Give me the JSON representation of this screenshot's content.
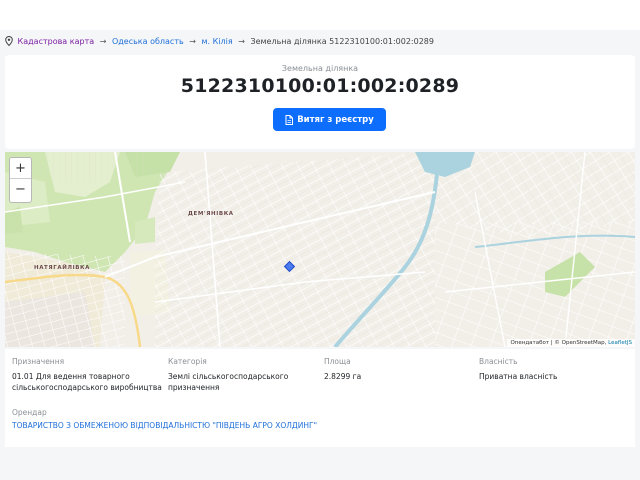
{
  "breadcrumb": {
    "items": [
      "Кадастрова карта",
      "Одеська область",
      "м. Кілія"
    ],
    "separator": "→",
    "current": "Земельна ділянка 5122310100:01:002:0289"
  },
  "plot": {
    "label": "Земельна ділянка",
    "number": "5122310100:01:002:0289",
    "button_label": "Витяг з реєстру"
  },
  "map": {
    "zoom_in": "+",
    "zoom_out": "−",
    "places": [
      "ДЕМ'ЯНІВКА",
      "НАТЯГАЙЛІВКА"
    ],
    "attribution": {
      "part1": "Опендатабот | © OpenStreetMap, ",
      "link": "LeafletJS"
    },
    "marker_color": "#4a7cf0"
  },
  "details": {
    "purpose_label": "Призначення",
    "purpose_value": "01.01 Для ведення товарного сільськогосподарського виробництва",
    "category_label": "Категорія",
    "category_value": "Землі сільськогосподарського призначення",
    "area_label": "Площа",
    "area_value": "2.8299 га",
    "ownership_label": "Власність",
    "ownership_value": "Приватна власність",
    "tenant_label": "Орендар",
    "tenant_value": "ТОВАРИСТВО З ОБМЕЖЕНОЮ ВІДПОВІДАЛЬНІСТЮ \"ПІВДЕНЬ АГРО ХОЛДИНГ\""
  },
  "colors": {
    "accent": "#0d6efd",
    "link": "#1e6fd9",
    "breadcrumb_root": "#7b1fa2"
  }
}
